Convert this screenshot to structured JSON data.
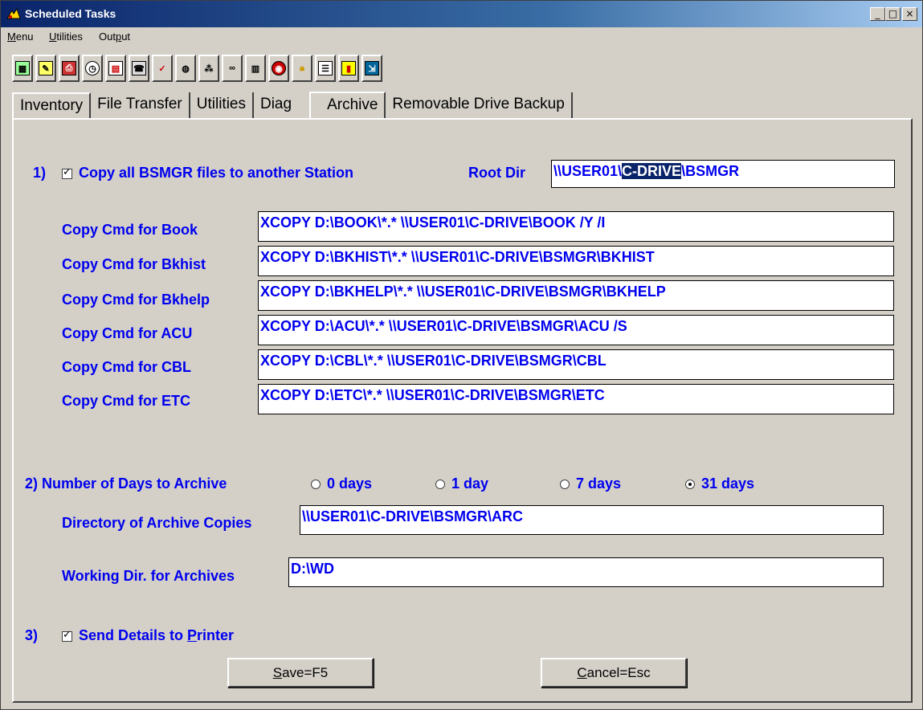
{
  "window": {
    "title": "Scheduled Tasks"
  },
  "menu": [
    {
      "label": "Menu"
    },
    {
      "label": "Utilities"
    },
    {
      "label": "Output"
    }
  ],
  "toolbar_icons": [
    "calculator-icon",
    "notepad-icon",
    "printer-icon",
    "clock-icon",
    "calendar-icon",
    "phone-icon",
    "spellcheck-icon",
    "binoculars-icon",
    "network-icon",
    "glasses-icon",
    "barcode-icon",
    "target-icon",
    "lock-icon",
    "properties-icon",
    "chart-icon",
    "exit-icon"
  ],
  "tabs": [
    "Inventory",
    "File Transfer",
    "Utilities",
    "Diag",
    "Archive",
    "Removable Drive Backup"
  ],
  "section1": {
    "number": "1)",
    "label": "Copy all BSMGR files to another Station",
    "checked": true,
    "root_dir_label": "Root Dir",
    "root_dir_pre": "\\\\USER01\\",
    "root_dir_selected": "C-DRIVE",
    "root_dir_post": "\\BSMGR"
  },
  "copy_cmds": [
    {
      "label": "Copy Cmd for Book",
      "value": "XCOPY D:\\BOOK\\*.* \\\\USER01\\C-DRIVE\\BOOK /Y /I"
    },
    {
      "label": "Copy Cmd for Bkhist",
      "value": "XCOPY D:\\BKHIST\\*.* \\\\USER01\\C-DRIVE\\BSMGR\\BKHIST"
    },
    {
      "label": "Copy Cmd for Bkhelp",
      "value": "XCOPY D:\\BKHELP\\*.* \\\\USER01\\C-DRIVE\\BSMGR\\BKHELP"
    },
    {
      "label": "Copy Cmd for ACU",
      "value": "XCOPY D:\\ACU\\*.* \\\\USER01\\C-DRIVE\\BSMGR\\ACU /S"
    },
    {
      "label": "Copy Cmd for CBL",
      "value": "XCOPY D:\\CBL\\*.* \\\\USER01\\C-DRIVE\\BSMGR\\CBL"
    },
    {
      "label": "Copy Cmd for ETC",
      "value": "XCOPY D:\\ETC\\*.* \\\\USER01\\C-DRIVE\\BSMGR\\ETC"
    }
  ],
  "section2": {
    "label": "2)  Number of Days to Archive",
    "options": [
      "0 days",
      "1 day",
      "7 days",
      "31 days"
    ],
    "selected": "31 days",
    "archive_dir_label": "Directory of Archive Copies",
    "archive_dir_value": "\\\\USER01\\C-DRIVE\\BSMGR\\ARC",
    "working_dir_label": "Working Dir. for Archives",
    "working_dir_value": "D:\\WD"
  },
  "section3": {
    "number": "3)",
    "label_pre": "Send Details to ",
    "label_ul": "P",
    "label_post": "rinter",
    "checked": true
  },
  "buttons": {
    "save_ul": "S",
    "save_rest": "ave=F5",
    "cancel_ul": "C",
    "cancel_rest": "ancel=Esc"
  },
  "colors": {
    "label": "#0000ee",
    "title_bar": "#0a246a",
    "face": "#d4d0c8"
  }
}
